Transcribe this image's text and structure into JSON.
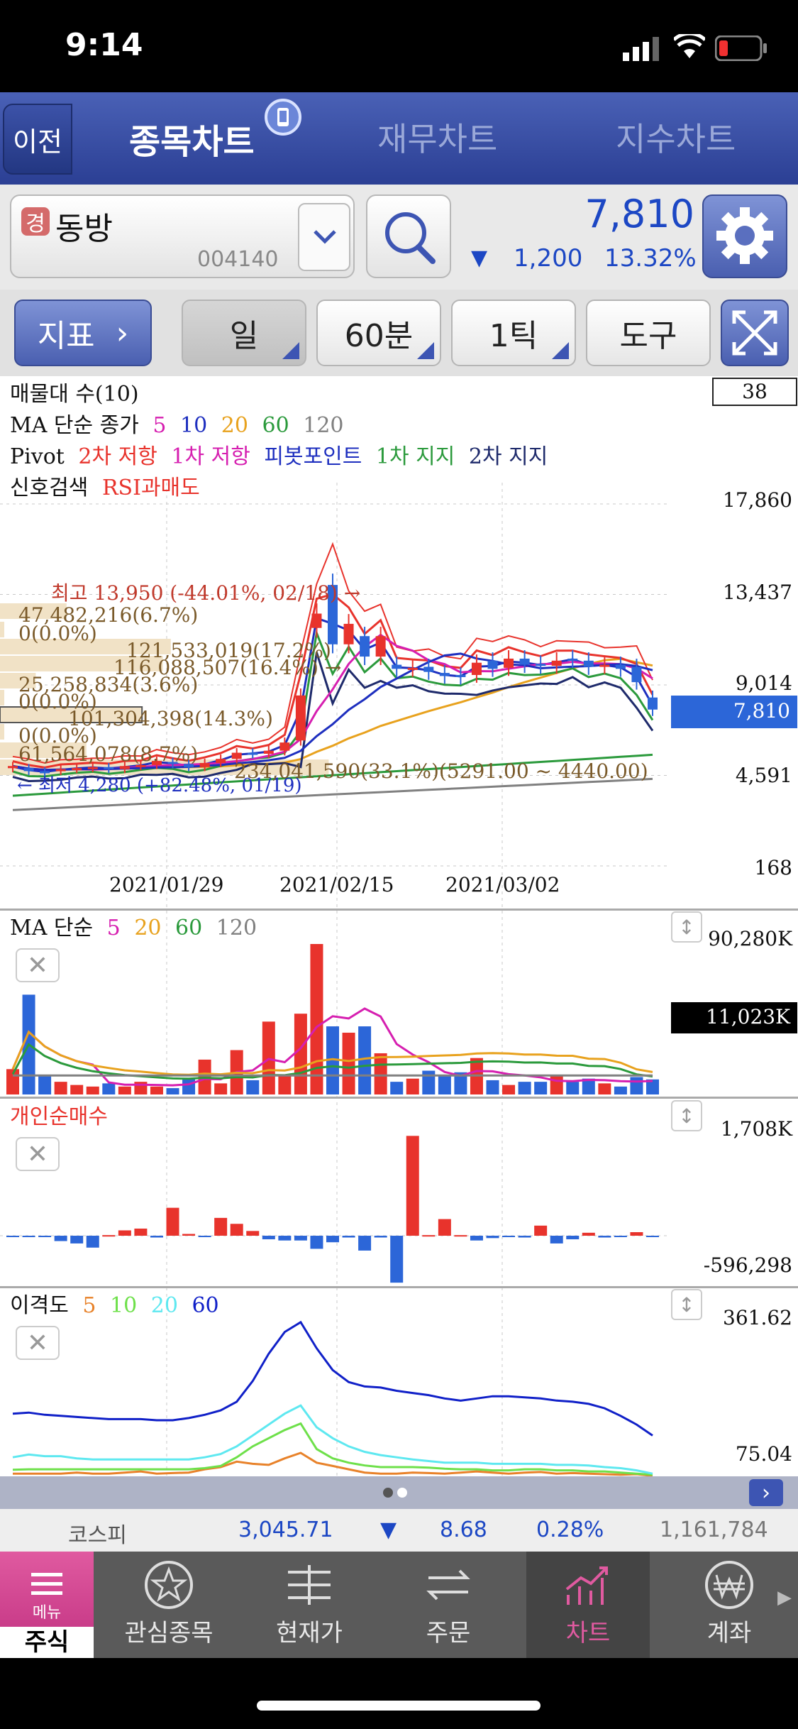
{
  "status": {
    "time": "9:14"
  },
  "nav": {
    "back": "이전",
    "tabs": [
      "종목차트",
      "재무차트",
      "지수차트"
    ]
  },
  "stock": {
    "badge": "경",
    "name": "동방",
    "code": "004140",
    "price": "7,810",
    "change": "1,200",
    "change_pct": "13.32%"
  },
  "toolbar": {
    "indicator": "지표",
    "period": "일",
    "minute": "60분",
    "tick": "1틱",
    "tools": "도구"
  },
  "main_chart": {
    "legend1": "매물대 수(10)",
    "legend2_label": "MA 단순 종가",
    "ma_periods": [
      "5",
      "10",
      "20",
      "60",
      "120"
    ],
    "pivot_label": "Pivot",
    "pivot_items": [
      "2차 저항",
      "1차 저항",
      "피봇포인트",
      "1차 지지",
      "2차 지지"
    ],
    "signal_label": "신호검색",
    "signal_item": "RSI과매도",
    "count_box": "38",
    "y_labels": [
      "17,860",
      "13,437",
      "9,014",
      "4,591",
      "168"
    ],
    "current_price": "7,810",
    "x_labels": [
      "2021/01/29",
      "2021/02/15",
      "2021/03/02"
    ],
    "high_note": "최고 13,950 (-44.01%, 02/18) →",
    "low_note": "← 최저 4,280 (+82.48%, 01/19)",
    "volume_profile": [
      "47,482,216(6.7%)",
      "0(0.0%)",
      "121,533,019(17.2%)",
      "116,088,507(16.4%) →",
      "25,258,834(3.6%)",
      "0(0.0%)",
      "101,304,398(14.3%)",
      "0(0.0%)",
      "61,564,078(8.7%)",
      "234,041,590(33.1%)(5291.00 ~ 4440.00)"
    ]
  },
  "volume_panel": {
    "label": "MA 단순",
    "periods": [
      "5",
      "20",
      "60",
      "120"
    ],
    "max": "90,280K",
    "current": "11,023K"
  },
  "retail_panel": {
    "label": "개인순매수",
    "max": "1,708K",
    "min": "-596,298"
  },
  "disparity_panel": {
    "label": "이격도",
    "periods": [
      "5",
      "10",
      "20",
      "60"
    ],
    "max": "361.62",
    "min": "75.04"
  },
  "kospi": {
    "name": "코스피",
    "value": "3,045.71",
    "change": "8.68",
    "pct": "0.28%",
    "volume": "1,161,784"
  },
  "tabs": [
    {
      "label": "주식",
      "sub": "메뉴",
      "icon": "menu-icon"
    },
    {
      "label": "관심종목",
      "icon": "star-refresh-icon"
    },
    {
      "label": "현재가",
      "icon": "price-list-icon"
    },
    {
      "label": "주문",
      "icon": "exchange-icon"
    },
    {
      "label": "차트",
      "icon": "chart-icon"
    },
    {
      "label": "계좌",
      "icon": "won-icon"
    }
  ],
  "colors": {
    "up": "#e8332c",
    "down": "#2c66d8",
    "ma5": "#d61fb0",
    "ma10": "#1e2fbf",
    "ma20": "#e8a21e",
    "ma60": "#2b9a3c",
    "ma120": "#808080",
    "nav": "#2b3f94"
  },
  "chart_data": [
    {
      "type": "candlestick",
      "ylim": [
        168,
        17860
      ],
      "y_ticks": [
        17860,
        13437,
        9014,
        4591,
        168
      ],
      "x_tick_labels": [
        "2021/01/29",
        "2021/02/15",
        "2021/03/02"
      ],
      "close": [
        5050,
        4800,
        4750,
        4900,
        4950,
        5000,
        4900,
        5050,
        5100,
        5300,
        5150,
        5000,
        5200,
        5400,
        5700,
        5650,
        5800,
        6200,
        8500,
        12500,
        11000,
        12000,
        10400,
        11400,
        9800,
        9850,
        9650,
        9450,
        9400,
        10100,
        9800,
        10300,
        10000,
        9950,
        10200,
        10250,
        9900,
        10000,
        9800,
        9150,
        7810
      ],
      "open": [
        4950,
        4950,
        4800,
        4800,
        4900,
        4950,
        5000,
        4900,
        5050,
        5100,
        5250,
        5150,
        5000,
        5200,
        5400,
        5700,
        5650,
        5800,
        6300,
        11800,
        13900,
        11000,
        11400,
        10400,
        10000,
        9800,
        9900,
        9600,
        9500,
        9500,
        10200,
        9850,
        10300,
        10050,
        9950,
        10300,
        10200,
        9950,
        10000,
        9900,
        8400
      ],
      "volume_k": [
        16000,
        63000,
        12000,
        8000,
        6000,
        5000,
        7000,
        5000,
        8000,
        5000,
        4000,
        10000,
        22000,
        7000,
        28000,
        9000,
        46000,
        12000,
        51000,
        95000,
        43000,
        39000,
        43000,
        26000,
        8000,
        10000,
        15000,
        12000,
        14000,
        23000,
        9000,
        6000,
        8000,
        8000,
        12000,
        8000,
        10000,
        7000,
        5000,
        11000,
        9500
      ],
      "retail_net_k": [
        -20,
        -20,
        -20,
        -90,
        -130,
        -200,
        10,
        90,
        120,
        -30,
        470,
        30,
        -10,
        300,
        200,
        80,
        -60,
        -80,
        -80,
        -220,
        -110,
        -30,
        -250,
        -30,
        -790,
        1680,
        10,
        280,
        10,
        -80,
        -40,
        -10,
        -30,
        170,
        -130,
        -60,
        50,
        -30,
        -20,
        60,
        -20
      ]
    },
    {
      "type": "line",
      "name": "이격도",
      "ylim": [
        75.04,
        361.62
      ],
      "series": [
        {
          "name": "5",
          "values": [
            80,
            80,
            80,
            80,
            82,
            80,
            80,
            82,
            84,
            80,
            81,
            82,
            88,
            92,
            102,
            98,
            96,
            108,
            118,
            100,
            94,
            88,
            82,
            80,
            80,
            82,
            81,
            80,
            82,
            84,
            82,
            80,
            82,
            83,
            80,
            81,
            80,
            79,
            78,
            79,
            76
          ]
        },
        {
          "name": "10",
          "values": [
            87,
            88,
            88,
            88,
            88,
            88,
            88,
            88,
            88,
            88,
            88,
            88,
            90,
            94,
            110,
            130,
            145,
            160,
            172,
            125,
            108,
            100,
            95,
            92,
            92,
            92,
            91,
            89,
            88,
            88,
            86,
            86,
            88,
            88,
            86,
            86,
            84,
            84,
            82,
            80,
            78
          ]
        },
        {
          "name": "20",
          "values": [
            110,
            115,
            112,
            112,
            108,
            106,
            106,
            106,
            106,
            106,
            106,
            106,
            110,
            116,
            130,
            150,
            170,
            190,
            205,
            165,
            145,
            130,
            120,
            114,
            110,
            106,
            103,
            100,
            100,
            100,
            98,
            98,
            98,
            98,
            96,
            96,
            95,
            92,
            90,
            86,
            80
          ]
        },
        {
          "name": "60",
          "values": [
            190,
            192,
            188,
            186,
            184,
            182,
            180,
            180,
            180,
            178,
            178,
            182,
            188,
            196,
            212,
            250,
            300,
            340,
            358,
            310,
            270,
            248,
            240,
            238,
            232,
            228,
            224,
            218,
            214,
            218,
            222,
            222,
            220,
            218,
            214,
            212,
            208,
            200,
            186,
            170,
            150
          ]
        }
      ]
    }
  ]
}
